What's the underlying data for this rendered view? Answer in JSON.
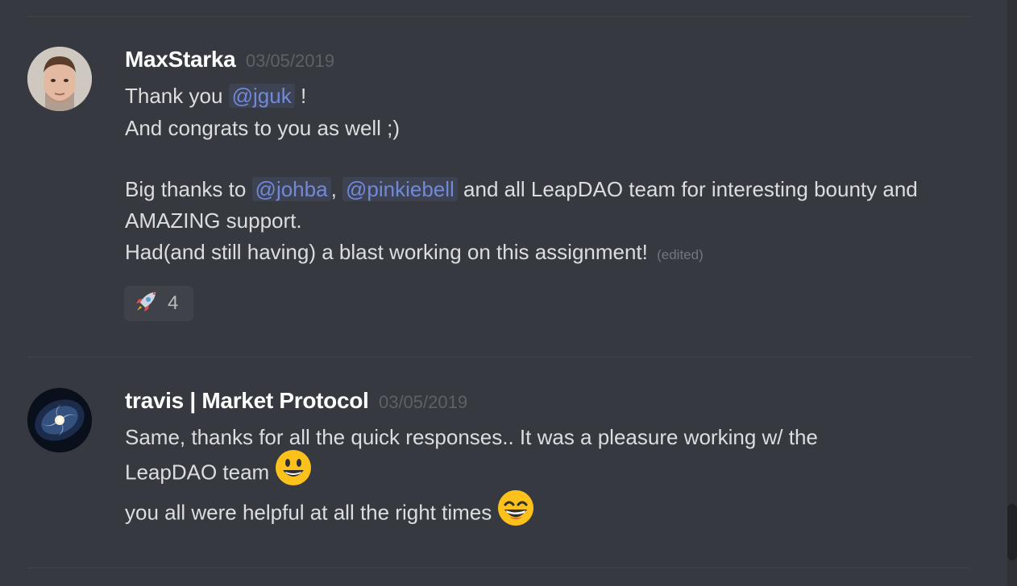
{
  "messages": [
    {
      "username": "MaxStarka",
      "timestamp": "03/05/2019",
      "avatar_icon": "user-photo-avatar",
      "line1_text": "Thank you ",
      "line1_mention": "@jguk",
      "line1_suffix": " !",
      "line2_text": "And congrats to you as well ;)",
      "line3_text": "Big thanks to ",
      "line3_mention1": "@johba",
      "line3_sep": ", ",
      "line3_mention2": "@pinkiebell",
      "line3_suffix": "  and all LeapDAO team for interesting bounty and",
      "line4_text": "AMAZING support.",
      "line5_text": "Had(and still having) a blast working on this assignment! ",
      "edited_label": "(edited)",
      "reaction": {
        "emoji": "rocket-icon",
        "count": "4"
      }
    },
    {
      "username": "travis | Market Protocol",
      "timestamp": "03/05/2019",
      "avatar_icon": "galaxy-avatar",
      "line1_text": "Same, thanks for all the quick responses.. It was a pleasure working w/ the",
      "line2_text": "LeapDAO team ",
      "line2_emoji": "smiley-emoji-icon",
      "line3_text": "you all were helpful at all the right times ",
      "line3_emoji": "grinning-smile-emoji-icon"
    }
  ],
  "colors": {
    "background": "#36393f",
    "mention": "#7289da",
    "username": "#ffffff",
    "timestamp": "#5e6166"
  }
}
